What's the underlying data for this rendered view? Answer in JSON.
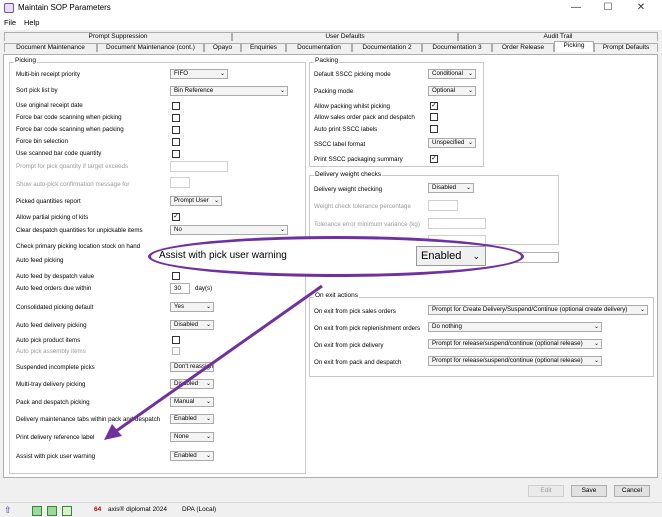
{
  "window": {
    "title": "Maintain SOP Parameters",
    "min": "—",
    "max": "☐",
    "close": "✕"
  },
  "menu": [
    "File",
    "Help"
  ],
  "tabs_row1": [
    "Prompt Suppression",
    "User Defaults",
    "Audit Trail"
  ],
  "tabs_row2": [
    "Document Maintenance",
    "Document Maintenance (cont.)",
    "Opayo",
    "Enquiries",
    "Documentation",
    "Documentation 2",
    "Documentation 3",
    "Order Release",
    "Picking",
    "Prompt Defaults"
  ],
  "picking": {
    "title": "Picking",
    "multibin": {
      "label": "Multi-bin receipt priority",
      "value": "FIFO"
    },
    "sortpick": {
      "label": "Sort pick list by",
      "value": "Bin Reference"
    },
    "use_receipt_date": {
      "label": "Use original receipt date",
      "checked": false
    },
    "force_scan_picking": {
      "label": "Force bar code scanning when picking",
      "checked": false
    },
    "force_scan_packing": {
      "label": "Force bar code scanning when packing",
      "checked": false
    },
    "force_bin": {
      "label": "Force bin selection",
      "checked": false
    },
    "use_scanned_qty": {
      "label": "Use scanned bar code quantity",
      "checked": false
    },
    "prompt_exceed": {
      "label": "Prompt for pick quantity if target exceeds"
    },
    "show_autopick": {
      "label": "Show auto-pick confirmation message for"
    },
    "picked_qty_report": {
      "label": "Picked quantities report",
      "value": "Prompt User"
    },
    "allow_partial_kits": {
      "label": "Allow partial picking of kits",
      "checked": true
    },
    "clear_despatch": {
      "label": "Clear despatch quantities for unpickable items",
      "value": "No"
    },
    "check_primary": {
      "label": "Check primary picking location stock on hand"
    },
    "auto_feed_picking": {
      "label": "Auto feed picking"
    },
    "auto_feed_despatch": {
      "label": "Auto feed by despatch value"
    },
    "auto_feed_orders": {
      "label": "Auto feed orders due within",
      "value": "30",
      "unit": "day(s)"
    },
    "consolidated": {
      "label": "Consolidated picking default",
      "value": "Yes"
    },
    "auto_feed_delivery": {
      "label": "Auto feed delivery picking",
      "value": "Disabled"
    },
    "auto_pick_product": {
      "label": "Auto pick product items",
      "checked": false
    },
    "auto_pick_assembly": {
      "label": "Auto pick assembly items"
    },
    "suspended": {
      "label": "Suspended incomplete picks",
      "value": "Don't reassign"
    },
    "multitray": {
      "label": "Multi-tray delivery picking",
      "value": "Disabled"
    },
    "pack_despatch": {
      "label": "Pack and despatch picking",
      "value": "Manual"
    },
    "delivery_tabs": {
      "label": "Delivery maintenance tabs within pack and despatch",
      "value": "Enabled"
    },
    "print_ref": {
      "label": "Print delivery reference label",
      "value": "None"
    },
    "assist_warning": {
      "label": "Assist with pick user warning",
      "value": "Enabled"
    }
  },
  "packing": {
    "title": "Packing",
    "default_sscc": {
      "label": "Default SSCC picking mode",
      "value": "Conditional"
    },
    "packing_mode": {
      "label": "Packing mode",
      "value": "Optional"
    },
    "allow_whilst": {
      "label": "Allow packing whilst picking",
      "checked": true
    },
    "allow_sales": {
      "label": "Allow sales order pack and despatch",
      "checked": false
    },
    "auto_print_sscc": {
      "label": "Auto print SSCC labels",
      "checked": false
    },
    "sscc_format": {
      "label": "SSCC label format",
      "value": "Unspecified"
    },
    "print_summary": {
      "label": "Print SSCC packaging summary",
      "checked": true
    }
  },
  "delivery_weight": {
    "title": "Delivery weight checks",
    "checking": {
      "label": "Delivery weight checking",
      "value": "Disabled"
    },
    "tolerance_pct": {
      "label": "Weight check tolerance percentage"
    },
    "tolerance_err": {
      "label": "Tolerance error minimum variance (kg)"
    }
  },
  "on_exit": {
    "title": "On exit actions",
    "sales": {
      "label": "On exit from pick sales orders",
      "value": "Prompt for Create Delivery/Suspend/Continue (optional create delivery)"
    },
    "replenishment": {
      "label": "On exit from pick replenishment orders",
      "value": "Do nothing"
    },
    "delivery": {
      "label": "On exit from pick delivery",
      "value": "Prompt for release/suspend/continue (optional release)"
    },
    "pack": {
      "label": "On exit from pack and despatch",
      "value": "Prompt for release/suspend/continue (optional release)"
    }
  },
  "buttons": {
    "edit": "Edit",
    "save": "Save",
    "cancel": "Cancel"
  },
  "status": {
    "product": "axis® diplomat 2024",
    "db": "DPA (Local)"
  },
  "callout": {
    "label": "Assist with pick user warning",
    "value": "Enabled"
  },
  "colors": {
    "callout": "#7030a0"
  }
}
